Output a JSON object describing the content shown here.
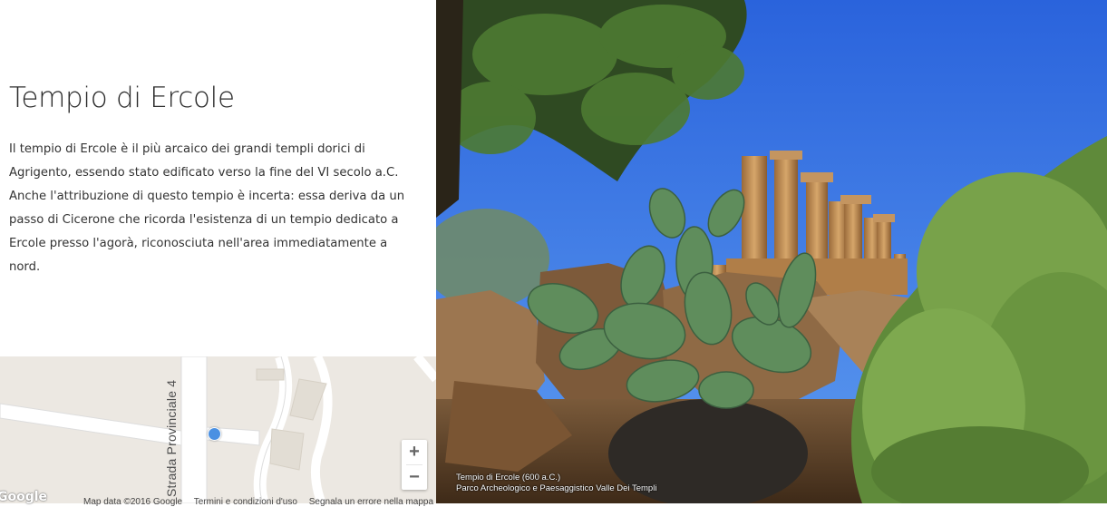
{
  "article": {
    "title": "Tempio di Ercole",
    "description": "Il tempio di Ercole è il più arcaico dei grandi templi dorici di Agrigento, essendo stato edificato verso la fine del VI secolo a.C. Anche l'attribuzione di questo tempio è incerta: essa deriva da un passo di Cicerone che ricorda l'esistenza di un tempio dedicato a Ercole presso l'agorà, riconosciuta nell'area immediatamente a nord."
  },
  "map": {
    "road_label": "Strada Provinciale 4",
    "zoom_in": "+",
    "zoom_out": "−",
    "logo": "Google",
    "map_data": "Map data ©2016 Google",
    "terms": "Termini e condizioni d'uso",
    "report": "Segnala un errore nella mappa"
  },
  "photo": {
    "caption_line1": "Tempio di Ercole (600 a.C.)",
    "caption_line2": "Parco Archeologico e Paesaggistico Valle Dei Templi"
  },
  "colors": {
    "sky": "#2f6fe0",
    "map_bg": "#ece8e2",
    "marker": "#4a90e2"
  }
}
